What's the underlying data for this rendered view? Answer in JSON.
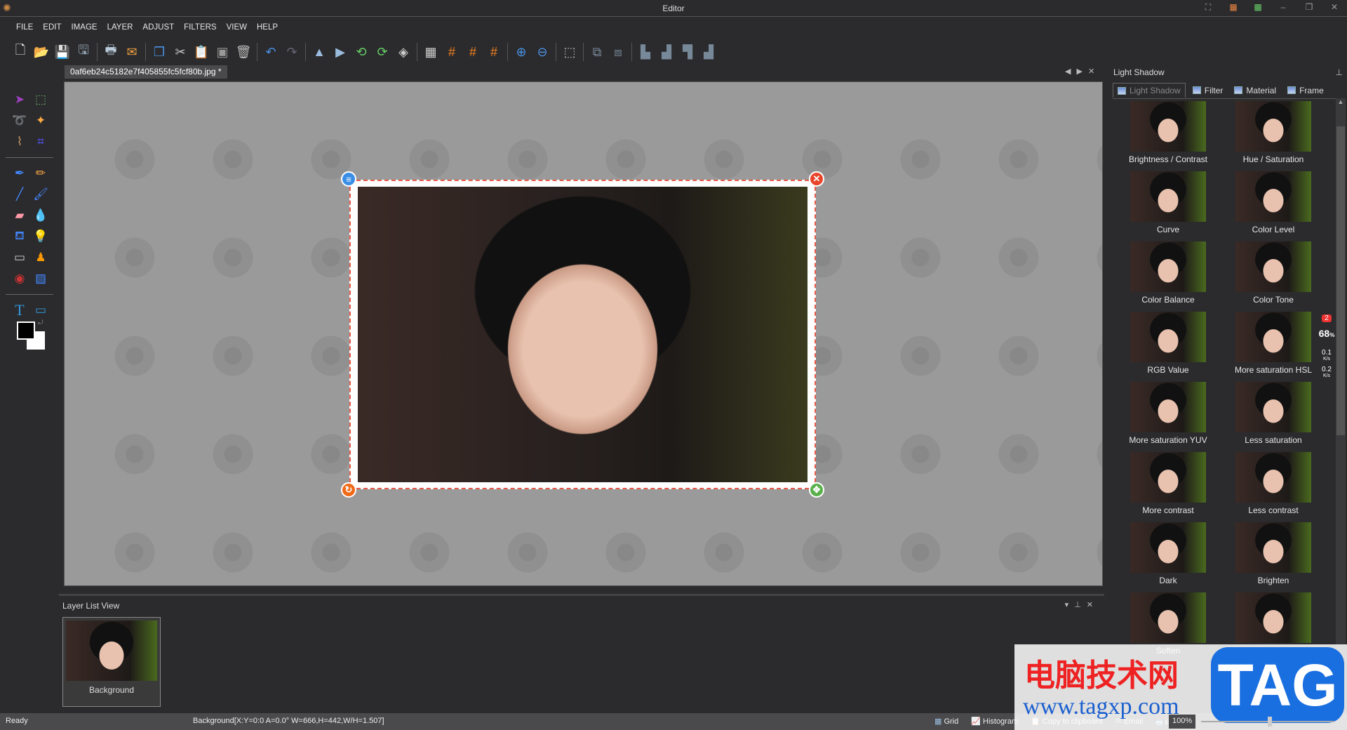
{
  "title": "Editor",
  "menu": [
    "FILE",
    "EDIT",
    "IMAGE",
    "LAYER",
    "ADJUST",
    "FILTERS",
    "VIEW",
    "HELP"
  ],
  "toolbar": [
    [
      "new-file",
      "🗋",
      "#eee"
    ],
    [
      "open",
      "📂",
      "#e8b84a"
    ],
    [
      "save",
      "💾",
      "#9ab"
    ],
    [
      "save-as",
      "🖫",
      "#9ab"
    ],
    "|",
    [
      "print",
      "🖶",
      "#bcd"
    ],
    [
      "email",
      "✉",
      "#f0a040"
    ],
    "|",
    [
      "copy-window",
      "❐",
      "#4a90e2"
    ],
    [
      "cut",
      "✂",
      "#ccc"
    ],
    [
      "paste",
      "📋",
      "#6c6"
    ],
    [
      "crop-doc",
      "▣",
      "#999"
    ],
    [
      "delete",
      "🗑",
      "#bbb"
    ],
    "|",
    [
      "undo",
      "↶",
      "#4a90e2"
    ],
    [
      "redo",
      "↷",
      "#667"
    ],
    "|",
    [
      "flip-vertical",
      "▲",
      "#9bd"
    ],
    [
      "flip-horizontal",
      "▶",
      "#9bd"
    ],
    [
      "rotate-left",
      "⟲",
      "#6c6"
    ],
    [
      "rotate-right",
      "⟳",
      "#6c6"
    ],
    [
      "rotate-free",
      "◈",
      "#ccc"
    ],
    "|",
    [
      "perspective",
      "▦",
      "#ccc"
    ],
    [
      "grid-1",
      "#",
      "#f08020"
    ],
    [
      "grid-2",
      "#",
      "#f08020"
    ],
    [
      "grid-3",
      "#",
      "#f08020"
    ],
    "|",
    [
      "zoom-in",
      "⊕",
      "#4a90e2"
    ],
    [
      "zoom-out",
      "⊖",
      "#4a90e2"
    ],
    "|",
    [
      "select-pointer",
      "⬚",
      "#bbb"
    ],
    "|",
    [
      "fit-canvas",
      "⧉",
      "#789"
    ],
    [
      "actual-size",
      "⧈",
      "#789"
    ],
    "|",
    [
      "align-left",
      "▙",
      "#789"
    ],
    [
      "align-center",
      "▟",
      "#789"
    ],
    [
      "align-top",
      "▜",
      "#789"
    ],
    [
      "align-bottom",
      "▟",
      "#789"
    ]
  ],
  "document_tab": "0af6eb24c5182e7f405855fc5fcf80b.jpg *",
  "tools": [
    [
      "move",
      "➤",
      "#a040c0"
    ],
    [
      "rect-select",
      "⬚",
      "#6a6"
    ],
    [
      "lasso",
      "➰",
      "#c96"
    ],
    [
      "magic-wand",
      "✦",
      "#fa4"
    ],
    [
      "poly-lasso",
      "⌇",
      "#c96"
    ],
    [
      "crop",
      "⌗",
      "#55f"
    ],
    "-",
    [
      "pen",
      "✒",
      "#48f"
    ],
    [
      "pencil",
      "✏",
      "#fa4"
    ],
    [
      "line",
      "╱",
      "#48f"
    ],
    [
      "brush",
      "🖌",
      "#48f"
    ],
    [
      "eraser",
      "▰",
      "#f9a"
    ],
    [
      "blur",
      "💧",
      "#8cf"
    ],
    [
      "fill-bucket",
      "⛾",
      "#48f"
    ],
    [
      "light-bulb",
      "💡",
      "#cc8"
    ],
    [
      "gradient",
      "▭",
      "#ccc"
    ],
    [
      "stamp",
      "♟",
      "#f90"
    ],
    [
      "red-eye",
      "◉",
      "#c33"
    ],
    [
      "picture",
      "▨",
      "#48f"
    ],
    "-",
    [
      "text",
      "T",
      "#39d"
    ],
    [
      "shape",
      "▭",
      "#39d"
    ]
  ],
  "right_panel": {
    "title": "Light Shadow",
    "tabs": [
      "Light Shadow",
      "Filter",
      "Material",
      "Frame"
    ],
    "items": [
      "Brightness / Contrast",
      "Hue / Saturation",
      "Curve",
      "Color Level",
      "Color Balance",
      "Color Tone",
      "RGB Value",
      "More saturation HSL",
      "More saturation YUV",
      "Less saturation",
      "More contrast",
      "Less contrast",
      "Dark",
      "Brighten",
      "Soften",
      ""
    ]
  },
  "layer_panel": {
    "title": "Layer List View",
    "layers": [
      {
        "name": "Background"
      }
    ]
  },
  "status": {
    "left": "Ready",
    "info": "Background[X:Y=0:0 A=0.0° W=666,H=442,W/H=1.507]",
    "buttons": [
      "Grid",
      "Histogram",
      "Copy to clipboard",
      "Email",
      "Print"
    ],
    "zoom": "100%"
  },
  "widget": {
    "badge": "2",
    "percent": "68",
    "unit": "%",
    "up": "0.1",
    "down": "0.2",
    "rate_unit": "K/s"
  },
  "watermark": {
    "cn": "电脑技术网",
    "url": "www.tagxp.com",
    "logo": "TAG"
  }
}
